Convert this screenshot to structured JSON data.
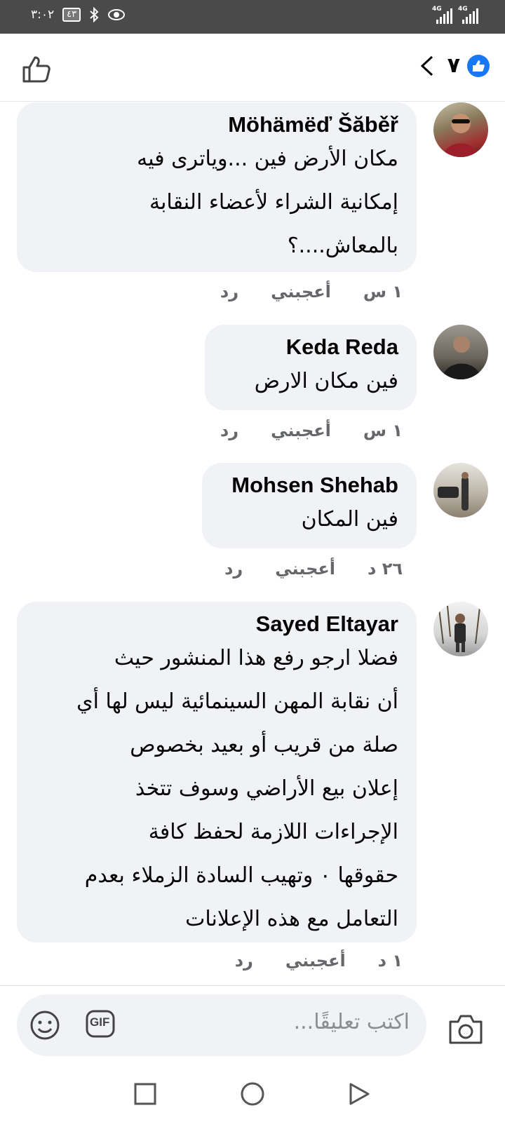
{
  "status_bar": {
    "time": "٣:٠٢",
    "battery": "٤٣",
    "network_1": "4G",
    "network_2": "4G"
  },
  "header": {
    "reaction_count": "٧",
    "like_icon": "like-icon",
    "back_icon": "chevron-left-icon",
    "thumb_icon": "thumbs-up-outline-icon"
  },
  "comments": [
    {
      "author": "Möhämëď Šăběř",
      "lines": [
        "مكان الأرض فين ...وياترى فيه",
        "إمكانية الشراء لأعضاء النقابة",
        "بالمعاش....؟"
      ],
      "time": "١ س",
      "like": "أعجبني",
      "reply": "رد"
    },
    {
      "author": "Keda Reda",
      "lines": [
        "فين مكان الارض"
      ],
      "time": "١ س",
      "like": "أعجبني",
      "reply": "رد"
    },
    {
      "author": "Mohsen Shehab",
      "lines": [
        "فين المكان"
      ],
      "time": "٢٦ د",
      "like": "أعجبني",
      "reply": "رد"
    },
    {
      "author": "Sayed Eltayar",
      "lines": [
        "فضلا ارجو رفع هذا المنشور حيث",
        "أن نقابة المهن السينمائية ليس لها أي",
        "صلة من قريب أو بعيد بخصوص",
        "إعلان بيع الأراضي وسوف تتخذ",
        "الإجراءات اللازمة لحفظ كافة",
        "حقوقها ٠ وتهيب السادة الزملاء بعدم",
        "التعامل مع هذه الإعلانات"
      ],
      "time": "١ د",
      "like": "أعجبني",
      "reply": "رد"
    }
  ],
  "composer": {
    "placeholder": "اكتب تعليقًا...",
    "gif_label": "GIF"
  },
  "colors": {
    "accent": "#1877f2",
    "bubble": "#f0f2f5",
    "status_bar": "#4a4a4a"
  }
}
